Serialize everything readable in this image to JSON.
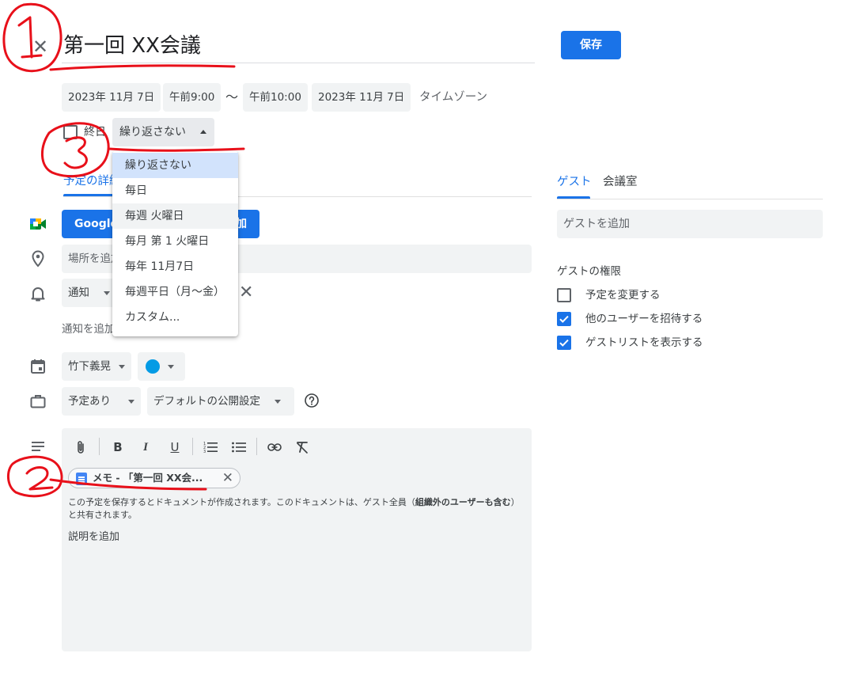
{
  "header": {
    "title": "第一回 XX会議",
    "save_label": "保存",
    "close_glyph": "✕"
  },
  "datetime": {
    "start_date": "2023年 11月 7日",
    "start_time": "午前9:00",
    "separator": "〜",
    "end_time": "午前10:00",
    "end_date": "2023年 11月 7日",
    "timezone_label": "タイムゾーン"
  },
  "allday": {
    "label": "終日",
    "checked": false
  },
  "recurrence": {
    "selected": "繰り返さない",
    "options": [
      "繰り返さない",
      "毎日",
      "毎週 火曜日",
      "毎月 第 1 火曜日",
      "毎年 11月7日",
      "毎週平日（月～金）",
      "カスタム..."
    ]
  },
  "details_tab_label": "予定の詳細",
  "meet": {
    "button_label": "Google",
    "button_suffix": "加"
  },
  "location": {
    "placeholder": "場所を追加"
  },
  "notification": {
    "type": "通知",
    "remove_glyph": "✕",
    "add_label": "通知を追加"
  },
  "owner": {
    "name": "竹下義晃",
    "color": "#039be5"
  },
  "availability": {
    "busy_label": "予定あり",
    "visibility_label": "デフォルトの公開設定"
  },
  "editor": {
    "toolbar": {
      "bold": "B",
      "italic": "I",
      "underline": "U"
    },
    "attachment_label": "メモ - 「第一回 XX会...",
    "attachment_remove": "✕",
    "share_notice_pre": "この予定を保存するとドキュメントが作成されます。このドキュメントは、ゲスト全員（",
    "share_notice_bold": "組織外のユーザーも含む",
    "share_notice_post": "）と共有されます。",
    "description_placeholder": "説明を追加"
  },
  "right_panel": {
    "tabs": [
      "ゲスト",
      "会議室"
    ],
    "guest_placeholder": "ゲストを追加",
    "permissions_heading": "ゲストの権限",
    "permissions": [
      {
        "label": "予定を変更する",
        "checked": false
      },
      {
        "label": "他のユーザーを招待する",
        "checked": true
      },
      {
        "label": "ゲストリストを表示する",
        "checked": true
      }
    ]
  },
  "annotations": {
    "color": "#e8101a",
    "labels": [
      "1",
      "2",
      "3"
    ]
  },
  "colors": {
    "accent": "#1a73e8",
    "field_bg": "#f1f3f4"
  }
}
